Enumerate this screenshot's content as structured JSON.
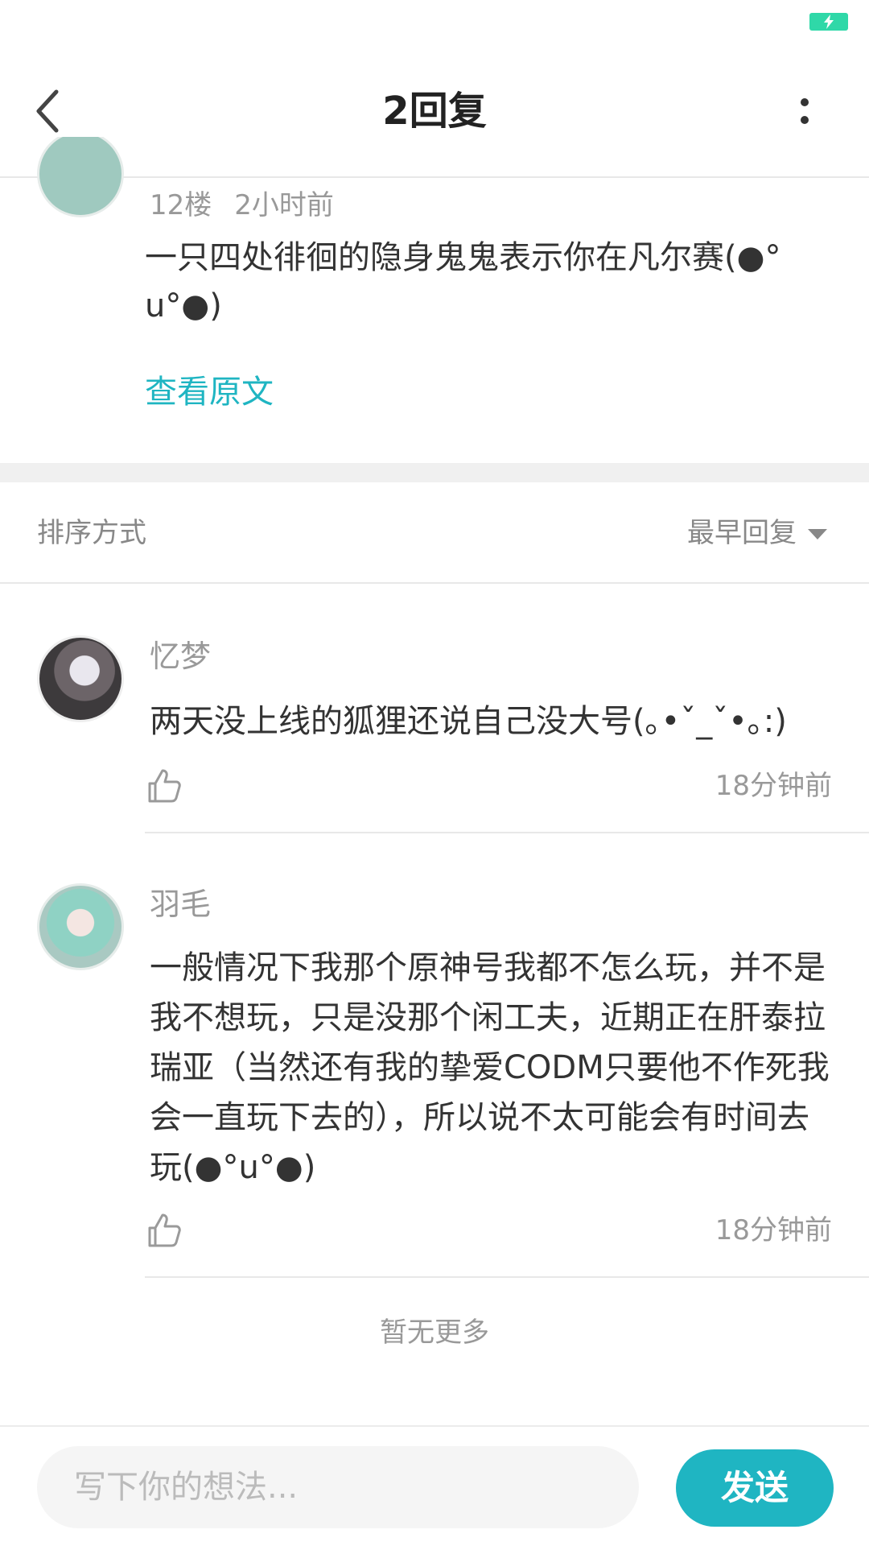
{
  "header": {
    "title": "2回复"
  },
  "original_post": {
    "floor": "12楼",
    "time": "2小时前",
    "text": "一只四处徘徊的隐身鬼鬼表示你在凡尔赛(●°u°●)",
    "view_original_label": "查看原文"
  },
  "sort": {
    "label": "排序方式",
    "selected": "最早回复"
  },
  "replies": [
    {
      "username": "忆梦",
      "text": "两天没上线的狐狸还说自己没大号(｡•ˇ_ˇ•｡:)",
      "time": "18分钟前"
    },
    {
      "username": "羽毛",
      "text": "一般情况下我那个原神号我都不怎么玩，并不是我不想玩，只是没那个闲工夫，近期正在肝泰拉瑞亚（当然还有我的挚爱CODM只要他不作死我会一直玩下去的），所以说不太可能会有时间去玩(●°u°●)",
      "time": "18分钟前"
    }
  ],
  "no_more_label": "暂无更多",
  "composer": {
    "placeholder": "写下你的想法...",
    "send_label": "发送"
  },
  "colors": {
    "accent": "#1fb5c2",
    "battery": "#2fd8a8"
  },
  "icons": {
    "back": "chevron-left-icon",
    "more": "more-vertical-icon",
    "like": "thumbs-up-icon",
    "sort_caret": "caret-down-icon",
    "battery": "battery-charging-icon"
  }
}
